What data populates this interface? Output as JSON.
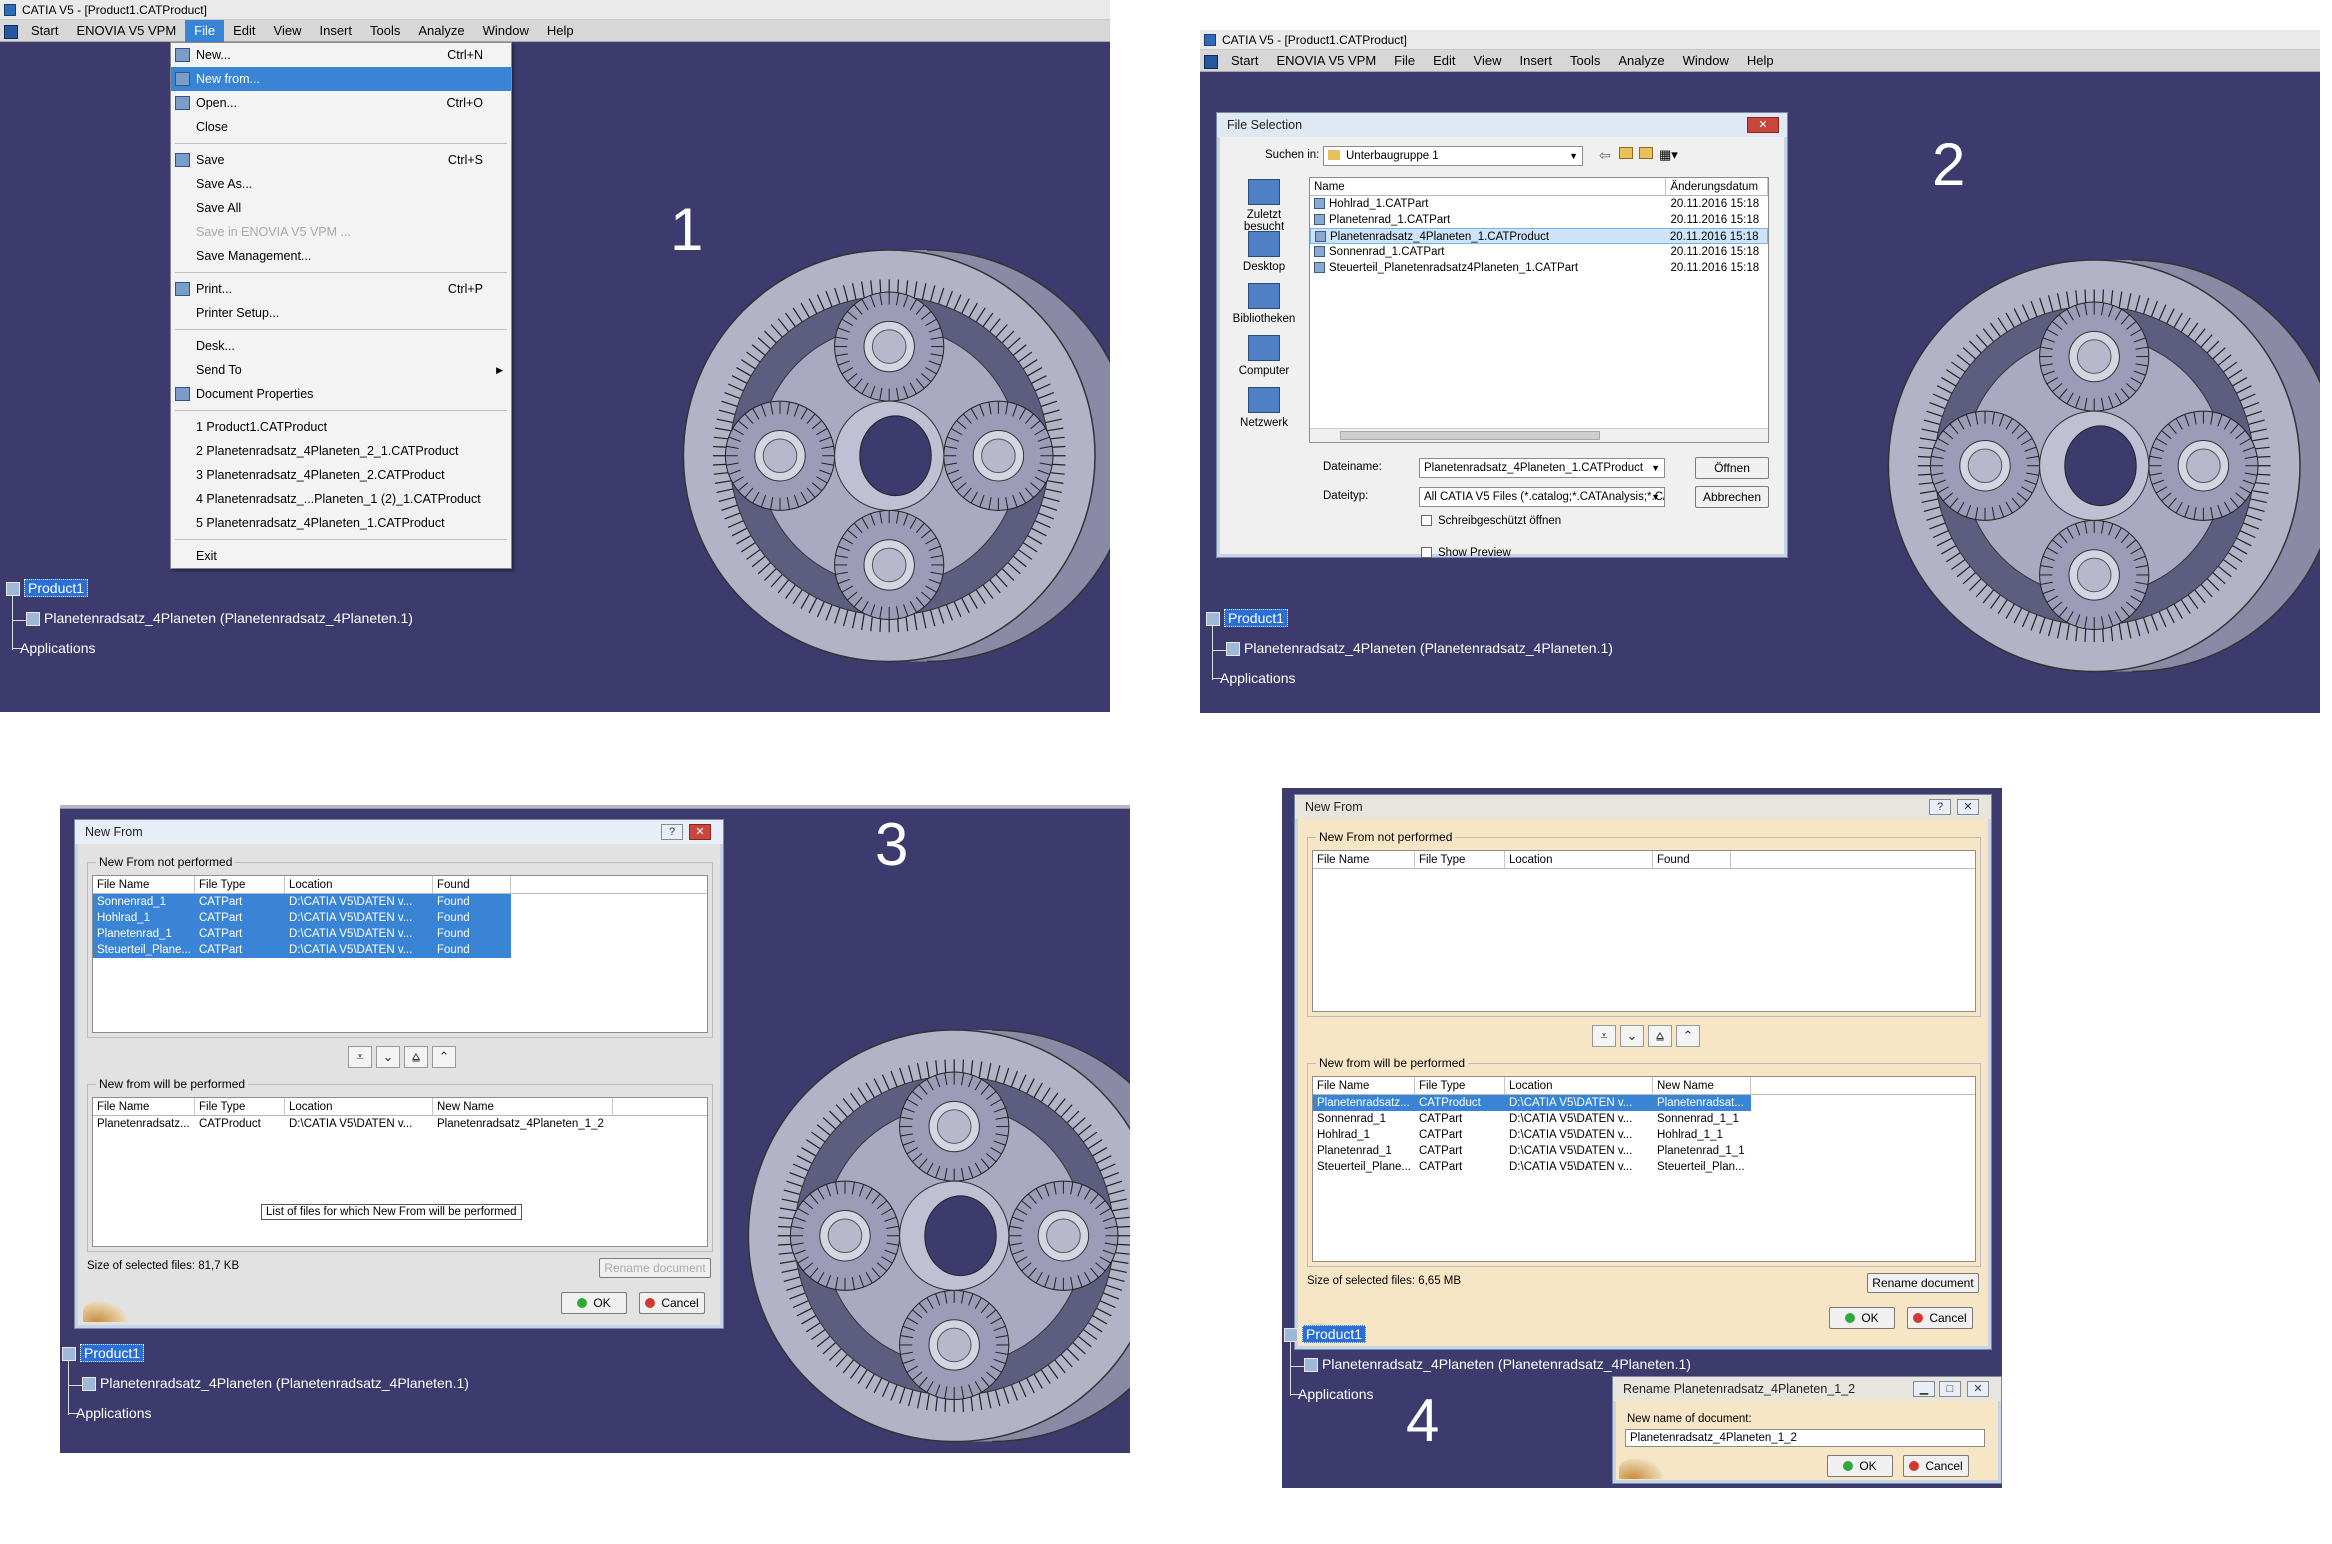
{
  "panel1": {
    "number": "1",
    "title": "CATIA V5 - [Product1.CATProduct]",
    "menu": [
      "Start",
      "ENOVIA V5 VPM",
      "File",
      "Edit",
      "View",
      "Insert",
      "Tools",
      "Analyze",
      "Window",
      "Help"
    ],
    "file_menu": [
      {
        "label": "New...",
        "shortcut": "Ctrl+N",
        "icon": "new-icon"
      },
      {
        "label": "New from...",
        "shortcut": "",
        "icon": "new-from-icon",
        "highlight": true
      },
      {
        "label": "Open...",
        "shortcut": "Ctrl+O",
        "icon": "open-icon"
      },
      {
        "label": "Close",
        "shortcut": ""
      },
      {
        "sep": true
      },
      {
        "label": "Save",
        "shortcut": "Ctrl+S",
        "icon": "save-icon"
      },
      {
        "label": "Save As...",
        "shortcut": ""
      },
      {
        "label": "Save All",
        "shortcut": ""
      },
      {
        "label": "Save in ENOVIA V5 VPM ...",
        "shortcut": "",
        "disabled": true
      },
      {
        "label": "Save Management...",
        "shortcut": ""
      },
      {
        "sep": true
      },
      {
        "label": "Print...",
        "shortcut": "Ctrl+P",
        "icon": "print-icon"
      },
      {
        "label": "Printer Setup...",
        "shortcut": ""
      },
      {
        "sep": true
      },
      {
        "label": "Desk...",
        "shortcut": ""
      },
      {
        "label": "Send To",
        "shortcut": "",
        "submenu": true
      },
      {
        "label": "Document Properties",
        "shortcut": "",
        "icon": "properties-icon"
      },
      {
        "sep": true
      },
      {
        "label": "1 Product1.CATProduct",
        "shortcut": ""
      },
      {
        "label": "2 Planetenradsatz_4Planeten_2_1.CATProduct",
        "shortcut": ""
      },
      {
        "label": "3 Planetenradsatz_4Planeten_2.CATProduct",
        "shortcut": ""
      },
      {
        "label": "4 Planetenradsatz_...Planeten_1 (2)_1.CATProduct",
        "shortcut": ""
      },
      {
        "label": "5 Planetenradsatz_4Planeten_1.CATProduct",
        "shortcut": ""
      },
      {
        "sep": true
      },
      {
        "label": "Exit",
        "shortcut": ""
      }
    ]
  },
  "tree": {
    "root": "Product1",
    "child": "Planetenradsatz_4Planeten (Planetenradsatz_4Planeten.1)",
    "apps": "Applications"
  },
  "panel2": {
    "number": "2",
    "title": "CATIA V5 - [Product1.CATProduct]",
    "dialog_title": "File Selection",
    "look_in_label": "Suchen in:",
    "look_in_value": "Unterbaugruppe 1",
    "places": [
      "Zuletzt besucht",
      "Desktop",
      "Bibliotheken",
      "Computer",
      "Netzwerk"
    ],
    "col_name": "Name",
    "col_date": "Änderungsdatum",
    "files": [
      {
        "name": "Hohlrad_1.CATPart",
        "date": "20.11.2016 15:18"
      },
      {
        "name": "Planetenrad_1.CATPart",
        "date": "20.11.2016 15:18"
      },
      {
        "name": "Planetenradsatz_4Planeten_1.CATProduct",
        "date": "20.11.2016 15:18",
        "selected": true
      },
      {
        "name": "Sonnenrad_1.CATPart",
        "date": "20.11.2016 15:18"
      },
      {
        "name": "Steuerteil_Planetenradsatz4Planeten_1.CATPart",
        "date": "20.11.2016 15:18"
      }
    ],
    "filename_label": "Dateiname:",
    "filename_value": "Planetenradsatz_4Planeten_1.CATProduct",
    "filetype_label": "Dateityp:",
    "filetype_value": "All CATIA V5 Files (*.catalog;*.CATAnalysis;*.C/",
    "readonly_label": "Schreibgeschützt öffnen",
    "preview_label": "Show Preview",
    "open_btn": "Öffnen",
    "cancel_btn": "Abbrechen"
  },
  "panel3": {
    "number": "3",
    "dialog_title": "New From",
    "group1": "New From not performed",
    "group2": "New from will be performed",
    "cols1": [
      "File Name",
      "File Type",
      "Location",
      "Found"
    ],
    "rows1": [
      [
        "Sonnenrad_1",
        "CATPart",
        "D:\\CATIA V5\\DATEN v...",
        "Found"
      ],
      [
        "Hohlrad_1",
        "CATPart",
        "D:\\CATIA V5\\DATEN v...",
        "Found"
      ],
      [
        "Planetenrad_1",
        "CATPart",
        "D:\\CATIA V5\\DATEN v...",
        "Found"
      ],
      [
        "Steuerteil_Plane...",
        "CATPart",
        "D:\\CATIA V5\\DATEN v...",
        "Found"
      ]
    ],
    "cols2": [
      "File Name",
      "File Type",
      "Location",
      "New Name"
    ],
    "rows2": [
      [
        "Planetenradsatz...",
        "CATProduct",
        "D:\\CATIA V5\\DATEN v...",
        "Planetenradsatz_4Planeten_1_2"
      ]
    ],
    "tooltip": "List of files for which New From will be performed",
    "size_label": "Size of selected files: 81,7 KB",
    "rename_btn": "Rename document",
    "ok": "OK",
    "cancel": "Cancel"
  },
  "panel4": {
    "number": "4",
    "dialog_title": "New From",
    "group1": "New From not performed",
    "group2": "New from will be performed",
    "cols1": [
      "File Name",
      "File Type",
      "Location",
      "Found"
    ],
    "cols2": [
      "File Name",
      "File Type",
      "Location",
      "New Name"
    ],
    "rows2": [
      [
        "Planetenradsatz...",
        "CATProduct",
        "D:\\CATIA V5\\DATEN v...",
        "Planetenradsat..."
      ],
      [
        "Sonnenrad_1",
        "CATPart",
        "D:\\CATIA V5\\DATEN v...",
        "Sonnenrad_1_1"
      ],
      [
        "Hohlrad_1",
        "CATPart",
        "D:\\CATIA V5\\DATEN v...",
        "Hohlrad_1_1"
      ],
      [
        "Planetenrad_1",
        "CATPart",
        "D:\\CATIA V5\\DATEN v...",
        "Planetenrad_1_1"
      ],
      [
        "Steuerteil_Plane...",
        "CATPart",
        "D:\\CATIA V5\\DATEN v...",
        "Steuerteil_Plan..."
      ]
    ],
    "size_label": "Size of selected files: 6,65 MB",
    "rename_btn": "Rename document",
    "ok": "OK",
    "cancel": "Cancel",
    "rename_title": "Rename Planetenradsatz_4Planeten_1_2",
    "rename_label": "New name of document:",
    "rename_value": "Planetenradsatz_4Planeten_1_2"
  }
}
